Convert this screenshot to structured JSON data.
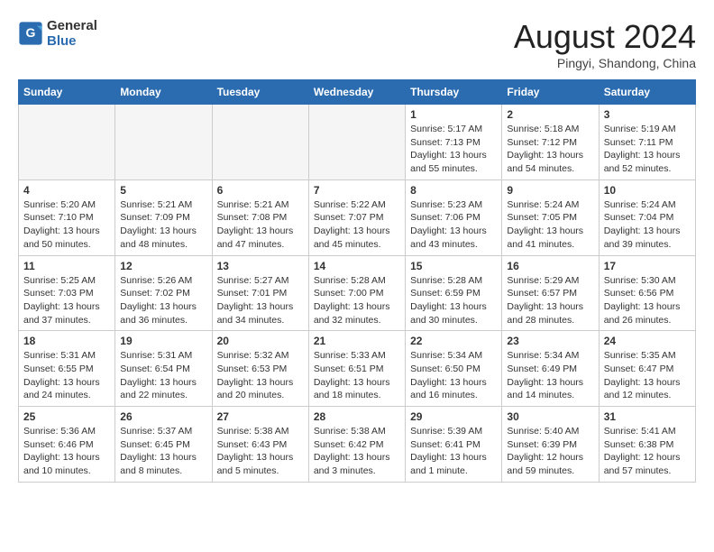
{
  "logo": {
    "line1": "General",
    "line2": "Blue"
  },
  "title": "August 2024",
  "location": "Pingyi, Shandong, China",
  "days_of_week": [
    "Sunday",
    "Monday",
    "Tuesday",
    "Wednesday",
    "Thursday",
    "Friday",
    "Saturday"
  ],
  "weeks": [
    [
      {
        "day": "",
        "empty": true
      },
      {
        "day": "",
        "empty": true
      },
      {
        "day": "",
        "empty": true
      },
      {
        "day": "",
        "empty": true
      },
      {
        "day": "1",
        "info": "Sunrise: 5:17 AM\nSunset: 7:13 PM\nDaylight: 13 hours\nand 55 minutes."
      },
      {
        "day": "2",
        "info": "Sunrise: 5:18 AM\nSunset: 7:12 PM\nDaylight: 13 hours\nand 54 minutes."
      },
      {
        "day": "3",
        "info": "Sunrise: 5:19 AM\nSunset: 7:11 PM\nDaylight: 13 hours\nand 52 minutes."
      }
    ],
    [
      {
        "day": "4",
        "info": "Sunrise: 5:20 AM\nSunset: 7:10 PM\nDaylight: 13 hours\nand 50 minutes."
      },
      {
        "day": "5",
        "info": "Sunrise: 5:21 AM\nSunset: 7:09 PM\nDaylight: 13 hours\nand 48 minutes."
      },
      {
        "day": "6",
        "info": "Sunrise: 5:21 AM\nSunset: 7:08 PM\nDaylight: 13 hours\nand 47 minutes."
      },
      {
        "day": "7",
        "info": "Sunrise: 5:22 AM\nSunset: 7:07 PM\nDaylight: 13 hours\nand 45 minutes."
      },
      {
        "day": "8",
        "info": "Sunrise: 5:23 AM\nSunset: 7:06 PM\nDaylight: 13 hours\nand 43 minutes."
      },
      {
        "day": "9",
        "info": "Sunrise: 5:24 AM\nSunset: 7:05 PM\nDaylight: 13 hours\nand 41 minutes."
      },
      {
        "day": "10",
        "info": "Sunrise: 5:24 AM\nSunset: 7:04 PM\nDaylight: 13 hours\nand 39 minutes."
      }
    ],
    [
      {
        "day": "11",
        "info": "Sunrise: 5:25 AM\nSunset: 7:03 PM\nDaylight: 13 hours\nand 37 minutes."
      },
      {
        "day": "12",
        "info": "Sunrise: 5:26 AM\nSunset: 7:02 PM\nDaylight: 13 hours\nand 36 minutes."
      },
      {
        "day": "13",
        "info": "Sunrise: 5:27 AM\nSunset: 7:01 PM\nDaylight: 13 hours\nand 34 minutes."
      },
      {
        "day": "14",
        "info": "Sunrise: 5:28 AM\nSunset: 7:00 PM\nDaylight: 13 hours\nand 32 minutes."
      },
      {
        "day": "15",
        "info": "Sunrise: 5:28 AM\nSunset: 6:59 PM\nDaylight: 13 hours\nand 30 minutes."
      },
      {
        "day": "16",
        "info": "Sunrise: 5:29 AM\nSunset: 6:57 PM\nDaylight: 13 hours\nand 28 minutes."
      },
      {
        "day": "17",
        "info": "Sunrise: 5:30 AM\nSunset: 6:56 PM\nDaylight: 13 hours\nand 26 minutes."
      }
    ],
    [
      {
        "day": "18",
        "info": "Sunrise: 5:31 AM\nSunset: 6:55 PM\nDaylight: 13 hours\nand 24 minutes."
      },
      {
        "day": "19",
        "info": "Sunrise: 5:31 AM\nSunset: 6:54 PM\nDaylight: 13 hours\nand 22 minutes."
      },
      {
        "day": "20",
        "info": "Sunrise: 5:32 AM\nSunset: 6:53 PM\nDaylight: 13 hours\nand 20 minutes."
      },
      {
        "day": "21",
        "info": "Sunrise: 5:33 AM\nSunset: 6:51 PM\nDaylight: 13 hours\nand 18 minutes."
      },
      {
        "day": "22",
        "info": "Sunrise: 5:34 AM\nSunset: 6:50 PM\nDaylight: 13 hours\nand 16 minutes."
      },
      {
        "day": "23",
        "info": "Sunrise: 5:34 AM\nSunset: 6:49 PM\nDaylight: 13 hours\nand 14 minutes."
      },
      {
        "day": "24",
        "info": "Sunrise: 5:35 AM\nSunset: 6:47 PM\nDaylight: 13 hours\nand 12 minutes."
      }
    ],
    [
      {
        "day": "25",
        "info": "Sunrise: 5:36 AM\nSunset: 6:46 PM\nDaylight: 13 hours\nand 10 minutes."
      },
      {
        "day": "26",
        "info": "Sunrise: 5:37 AM\nSunset: 6:45 PM\nDaylight: 13 hours\nand 8 minutes."
      },
      {
        "day": "27",
        "info": "Sunrise: 5:38 AM\nSunset: 6:43 PM\nDaylight: 13 hours\nand 5 minutes."
      },
      {
        "day": "28",
        "info": "Sunrise: 5:38 AM\nSunset: 6:42 PM\nDaylight: 13 hours\nand 3 minutes."
      },
      {
        "day": "29",
        "info": "Sunrise: 5:39 AM\nSunset: 6:41 PM\nDaylight: 13 hours\nand 1 minute."
      },
      {
        "day": "30",
        "info": "Sunrise: 5:40 AM\nSunset: 6:39 PM\nDaylight: 12 hours\nand 59 minutes."
      },
      {
        "day": "31",
        "info": "Sunrise: 5:41 AM\nSunset: 6:38 PM\nDaylight: 12 hours\nand 57 minutes."
      }
    ]
  ]
}
